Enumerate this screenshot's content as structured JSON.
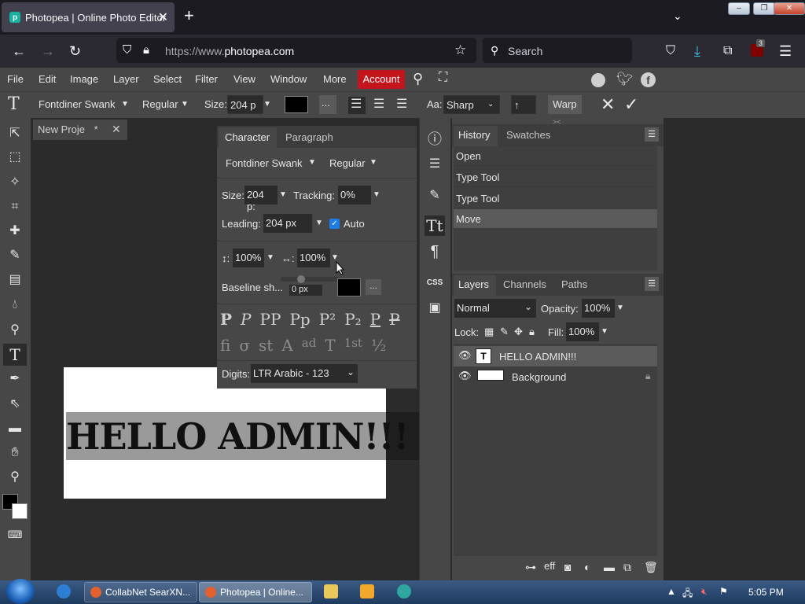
{
  "browser": {
    "tab_title": "Photopea | Online Photo Editor",
    "url_prefix": "https://www.",
    "url_domain": "photopea.com",
    "search_placeholder": "Search",
    "badge_count": "3"
  },
  "menu": {
    "items": [
      "File",
      "Edit",
      "Image",
      "Layer",
      "Select",
      "Filter",
      "View",
      "Window",
      "More"
    ],
    "account": "Account"
  },
  "options": {
    "font_family": "Fontdiner Swank",
    "font_style": "Regular",
    "size_label": "Size:",
    "size_value": "204 p",
    "ellipsis": "...",
    "aa_label": "Aa:",
    "aa_value": "Sharp",
    "direction": "↑",
    "warp": "Warp"
  },
  "document": {
    "tab_name": "New Proje",
    "tab_modified": "*",
    "canvas_text": "HELLO ADMIN!!!"
  },
  "character": {
    "tabs": [
      "Character",
      "Paragraph"
    ],
    "font_family": "Fontdiner Swank",
    "font_style": "Regular",
    "size_label": "Size:",
    "size_value": "204 p:",
    "tracking_label": "Tracking:",
    "tracking_value": "0%",
    "leading_label": "Leading:",
    "leading_value": "204 px",
    "auto_label": "Auto",
    "vscale_label": "↕:",
    "vscale_value": "100%",
    "hscale_label": "↔:",
    "hscale_value": "100%",
    "baseline_label": "Baseline sh...",
    "baseline_value": "0 px",
    "ellipsis": "...",
    "glyphs_row1": [
      "P",
      "P",
      "PP",
      "Pp",
      "P²",
      "P₂",
      "P",
      "P"
    ],
    "glyphs_row2": [
      "fi",
      "σ",
      "st",
      "A",
      "ad",
      "T",
      "1st",
      "½"
    ],
    "digits_label": "Digits:",
    "digits_value": "LTR Arabic - 123"
  },
  "side_icons": [
    "info-icon",
    "adjustments-icon",
    "brush-icon",
    "character-icon",
    "paragraph-icon",
    "css-icon",
    "image-icon"
  ],
  "side_labels": {
    "css": "CSS"
  },
  "history": {
    "tabs": [
      "History",
      "Swatches"
    ],
    "items": [
      "Open",
      "Type Tool",
      "Type Tool",
      "Move"
    ]
  },
  "layers": {
    "tabs": [
      "Layers",
      "Channels",
      "Paths"
    ],
    "blend_mode": "Normal",
    "opacity_label": "Opacity:",
    "opacity_value": "100%",
    "lock_label": "Lock:",
    "fill_label": "Fill:",
    "fill_value": "100%",
    "items": [
      {
        "name": "HELLO ADMIN!!!",
        "type": "text"
      },
      {
        "name": "Background",
        "type": "image"
      }
    ]
  },
  "taskbar": {
    "buttons": [
      "CollabNet SearXN...",
      "Photopea | Online..."
    ],
    "time": "5:05 PM"
  },
  "colors": {
    "accent_red": "#c4141c",
    "panel_bg": "#474747",
    "workspace_bg": "#2b2b2b"
  }
}
